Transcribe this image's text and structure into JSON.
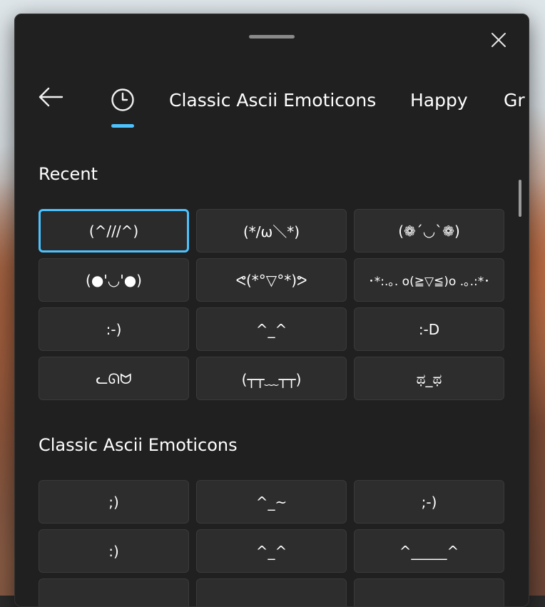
{
  "header": {
    "close_icon": "close-icon",
    "back_icon": "back-arrow-icon"
  },
  "tabs": [
    {
      "label": "",
      "icon": "clock-icon",
      "selected": true
    },
    {
      "label": "Classic Ascii Emoticons",
      "selected": false
    },
    {
      "label": "Happy",
      "selected": false
    },
    {
      "label": "Gr",
      "selected": false
    }
  ],
  "recent": {
    "title": "Recent",
    "items": [
      {
        "label": "(^///^)",
        "selected": true
      },
      {
        "label": "(*/ω＼*)"
      },
      {
        "label": "(❁´◡`❁)"
      },
      {
        "label": "(●'◡'●)"
      },
      {
        "label": "ᕙ(*°▽°*)ᕗ"
      },
      {
        "label": "･*:.｡. o(≧▽≦)o .｡.:*･"
      },
      {
        "label": ":-)"
      },
      {
        "label": "^_^"
      },
      {
        "label": ":-D"
      },
      {
        "label": "ᓚᘏᗢ"
      },
      {
        "label": "(┬┬﹏┬┬)"
      },
      {
        "label": "ಥ_ಥ"
      }
    ]
  },
  "classic": {
    "title": "Classic Ascii Emoticons",
    "items": [
      {
        "label": ";)"
      },
      {
        "label": "^_~"
      },
      {
        "label": ";-)"
      },
      {
        "label": ":)"
      },
      {
        "label": "^_^"
      },
      {
        "label": "^_____^"
      }
    ]
  },
  "colors": {
    "accent": "#4cc2ff",
    "panel_bg": "#202020",
    "cell_bg": "#2d2d2d"
  }
}
